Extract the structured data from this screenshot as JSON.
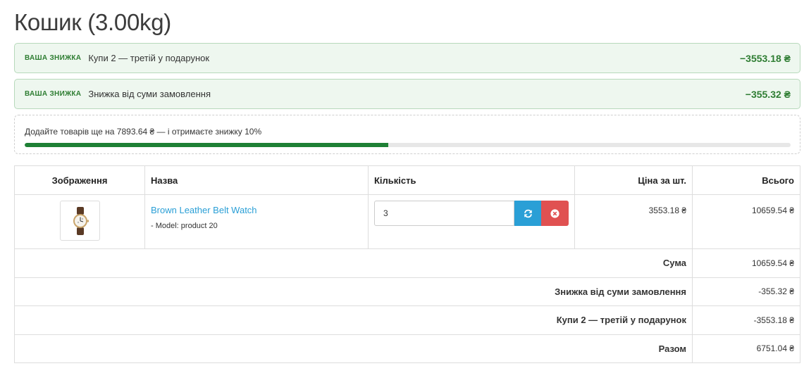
{
  "page": {
    "title": "Кошик (3.00kg)"
  },
  "discounts": [
    {
      "badge": "ВАША ЗНИЖКА",
      "text": "Купи 2 — третій у подарунок",
      "amount": "−3553.18 ₴"
    },
    {
      "badge": "ВАША ЗНИЖКА",
      "text": "Знижка від суми замовлення",
      "amount": "−355.32 ₴"
    }
  ],
  "progress": {
    "text": "Додайте товарів ще на 7893.64 ₴ — і отримаєте знижку 10%",
    "fraction": 0.4747
  },
  "table": {
    "headers": {
      "image": "Зображення",
      "name": "Назва",
      "quantity": "Кількість",
      "unit_price": "Ціна за шт.",
      "total": "Всього"
    },
    "items": [
      {
        "image_icon": "watch-icon",
        "name": "Brown Leather Belt Watch",
        "model": "- Model: product 20",
        "quantity": "3",
        "unit_price": "3553.18 ₴",
        "total": "10659.54 ₴"
      }
    ],
    "totals": [
      {
        "label": "Сума",
        "value": "10659.54 ₴"
      },
      {
        "label": "Знижка від суми замовлення",
        "value": "-355.32 ₴"
      },
      {
        "label": "Купи 2 — третій у подарунок",
        "value": "-3553.18 ₴"
      },
      {
        "label": "Разом",
        "value": "6751.04 ₴"
      }
    ]
  },
  "colors": {
    "discount_green": "#2e7d32",
    "progress_fill": "#1e8035",
    "link_blue": "#2a9fd6",
    "refresh_button": "#2a9fd6",
    "remove_button": "#e05151"
  },
  "icons": {
    "refresh": "refresh-icon",
    "remove": "remove-circle-icon"
  }
}
